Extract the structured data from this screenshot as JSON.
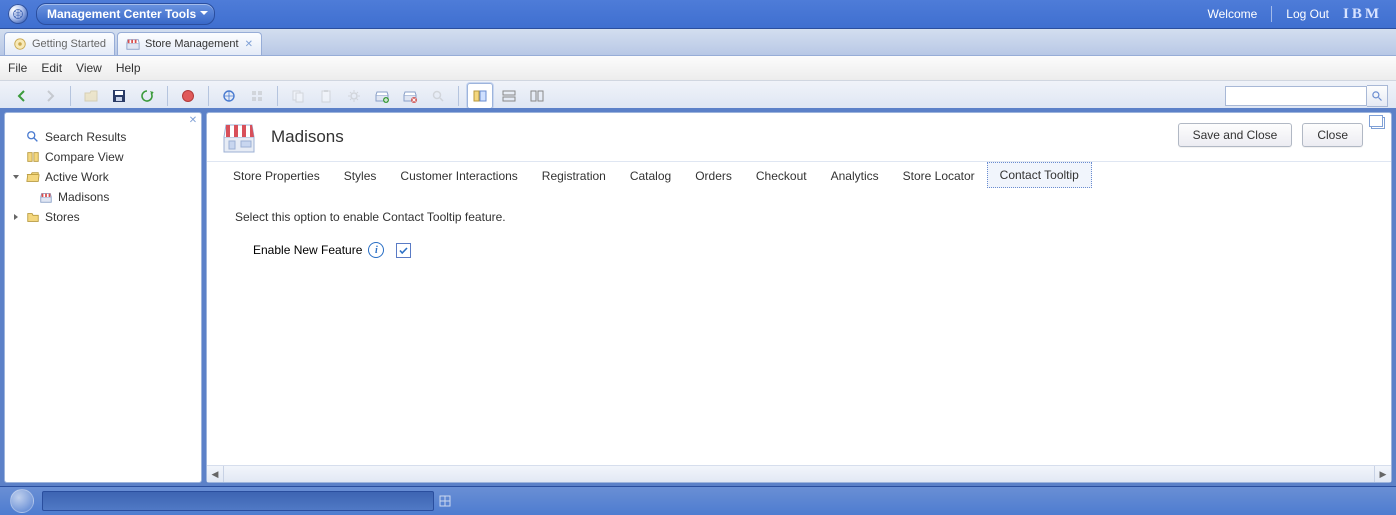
{
  "topbar": {
    "menu_title": "Management Center Tools",
    "welcome": "Welcome",
    "logout": "Log Out",
    "ibm": "IBM"
  },
  "tabs": [
    {
      "label": "Getting Started",
      "active": false
    },
    {
      "label": "Store Management",
      "active": true
    }
  ],
  "menubar": [
    "File",
    "Edit",
    "View",
    "Help"
  ],
  "tree": {
    "search_results": "Search Results",
    "compare_view": "Compare View",
    "active_work": "Active Work",
    "madisons": "Madisons",
    "stores": "Stores"
  },
  "main": {
    "title": "Madisons",
    "save_and_close": "Save and Close",
    "close": "Close",
    "tabs": [
      "Store Properties",
      "Styles",
      "Customer Interactions",
      "Registration",
      "Catalog",
      "Orders",
      "Checkout",
      "Analytics",
      "Store Locator",
      "Contact Tooltip"
    ],
    "selected_tab_index": 9,
    "description": "Select this option to enable Contact Tooltip feature.",
    "feature_label": "Enable New Feature",
    "feature_checked": true
  },
  "search": {
    "placeholder": ""
  }
}
